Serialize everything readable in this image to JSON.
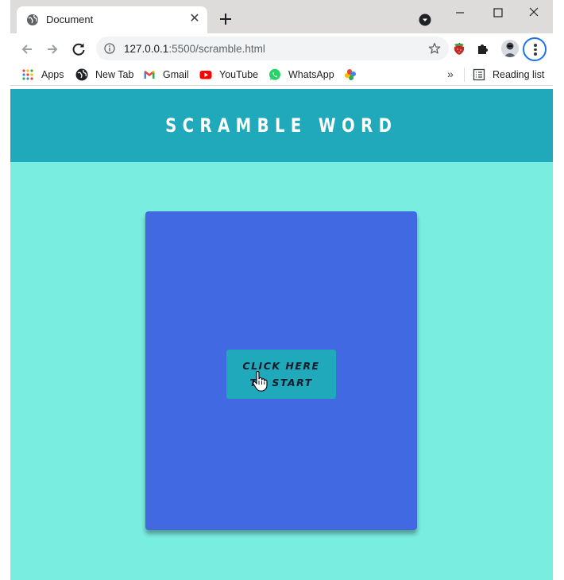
{
  "browser": {
    "tab": {
      "title": "Document",
      "close_label": "✕"
    },
    "window_controls": {
      "minimize": "—",
      "maximize": "☐",
      "close": "✕"
    },
    "address_bar": {
      "host": "127.0.0.1",
      "path": ":5500/scramble.html"
    },
    "bookmarks": [
      {
        "label": "Apps",
        "icon": "apps-grid-icon"
      },
      {
        "label": "New Tab",
        "icon": "globe-icon"
      },
      {
        "label": "Gmail",
        "icon": "gmail-icon"
      },
      {
        "label": "YouTube",
        "icon": "youtube-icon"
      },
      {
        "label": "WhatsApp",
        "icon": "whatsapp-icon"
      },
      {
        "label": "",
        "icon": "google-photos-icon"
      }
    ],
    "bookmarks_overflow": "»",
    "reading_list": "Reading list"
  },
  "page": {
    "header_title": "SCRAMBLE WORD",
    "start_button_label": "CLICK HERE TO START",
    "colors": {
      "background": "#7aede1",
      "header": "#20a8bb",
      "card": "#4169e1",
      "button": "#20a8bb"
    }
  }
}
